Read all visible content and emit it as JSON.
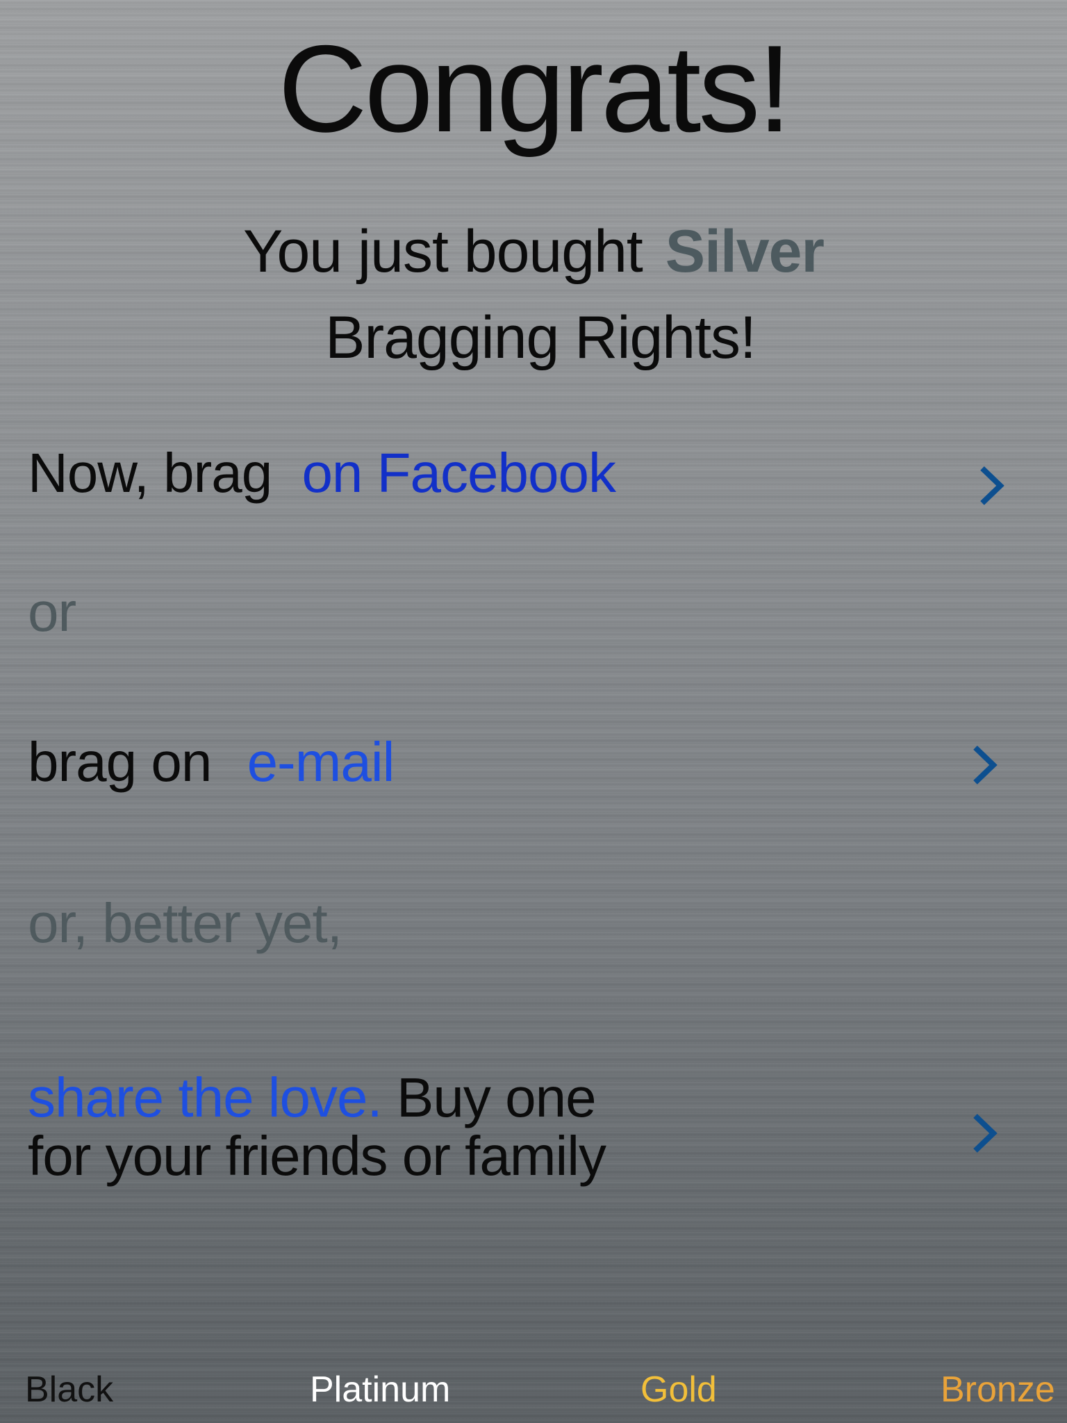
{
  "header": {
    "title": "Congrats!",
    "subtitle_prefix": "You just bought",
    "subtitle_tier": "Silver",
    "subtitle_line2": "Bragging Rights!"
  },
  "facebook_row": {
    "prefix": "Now, brag",
    "link": "on Facebook"
  },
  "separator_1": "or",
  "email_row": {
    "prefix": "brag on",
    "link": "e-mail"
  },
  "separator_2": "or, better yet,",
  "share_row": {
    "link": "share the love.",
    "rest_line1": "Buy one",
    "line2": "for your friends or family"
  },
  "tiers": [
    {
      "label": "Black",
      "color": "#111111"
    },
    {
      "label": "Platinum",
      "color": "#ffffff"
    },
    {
      "label": "Gold",
      "color": "#f2bf3a"
    },
    {
      "label": "Bronze",
      "color": "#e9a33a"
    }
  ],
  "colors": {
    "facebook_link": "#1230c8",
    "email_link": "#1e4fe0",
    "share_link": "#1e4fe0",
    "chevron": "#0d4f8f",
    "silver_tier": "#4d5a5f"
  }
}
